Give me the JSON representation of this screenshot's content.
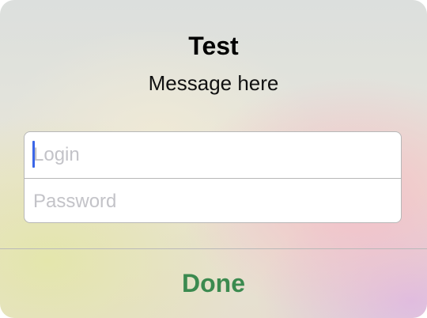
{
  "alert": {
    "title": "Test",
    "message": "Message here",
    "login_field": {
      "value": "",
      "placeholder": "Login",
      "focused": true
    },
    "password_field": {
      "value": "",
      "placeholder": "Password"
    },
    "done_label": "Done"
  },
  "colors": {
    "button_tint": "#3b8a4f",
    "caret": "#3b66e8",
    "placeholder": "#c3c3c8"
  }
}
